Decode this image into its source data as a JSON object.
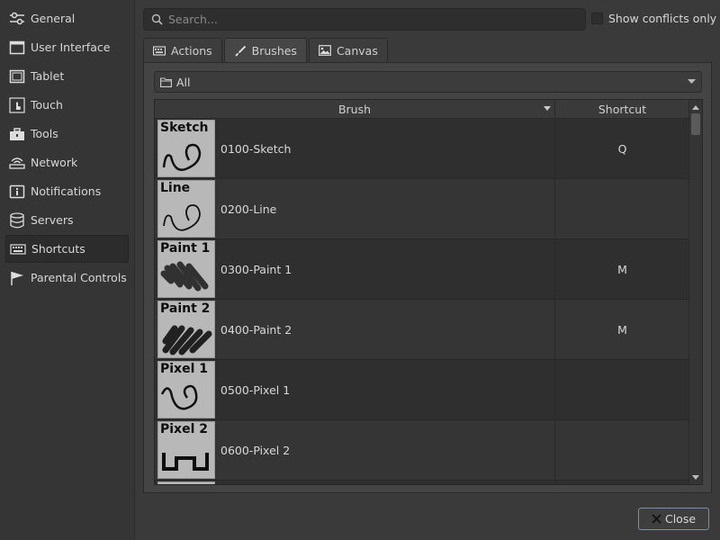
{
  "sidebar": {
    "items": [
      {
        "label": "General",
        "icon": "sliders-icon"
      },
      {
        "label": "User Interface",
        "icon": "window-icon"
      },
      {
        "label": "Tablet",
        "icon": "tablet-icon"
      },
      {
        "label": "Touch",
        "icon": "touch-icon"
      },
      {
        "label": "Tools",
        "icon": "toolbox-icon"
      },
      {
        "label": "Network",
        "icon": "router-icon"
      },
      {
        "label": "Notifications",
        "icon": "info-icon"
      },
      {
        "label": "Servers",
        "icon": "database-icon"
      },
      {
        "label": "Shortcuts",
        "icon": "keyboard-icon",
        "active": true
      },
      {
        "label": "Parental Controls",
        "icon": "flag-icon"
      }
    ]
  },
  "search": {
    "placeholder": "Search...",
    "value": ""
  },
  "conflicts": {
    "label": "Show conflicts only",
    "checked": false
  },
  "tabs": [
    {
      "label": "Actions",
      "icon": "keyboard-icon",
      "active": false
    },
    {
      "label": "Brushes",
      "icon": "brush-icon",
      "active": true
    },
    {
      "label": "Canvas",
      "icon": "image-icon",
      "active": false
    }
  ],
  "filter": {
    "value": "All",
    "icon": "folder-icon"
  },
  "table": {
    "headers": {
      "brush": "Brush",
      "shortcut": "Shortcut"
    },
    "rows": [
      {
        "thumb_title": "Sketch",
        "name": "0100-Sketch",
        "shortcut": "Q"
      },
      {
        "thumb_title": "Line",
        "name": "0200-Line",
        "shortcut": ""
      },
      {
        "thumb_title": "Paint 1",
        "name": "0300-Paint 1",
        "shortcut": "M"
      },
      {
        "thumb_title": "Paint 2",
        "name": "0400-Paint 2",
        "shortcut": "M"
      },
      {
        "thumb_title": "Pixel 1",
        "name": "0500-Pixel 1",
        "shortcut": ""
      },
      {
        "thumb_title": "Pixel 2",
        "name": "0600-Pixel 2",
        "shortcut": ""
      },
      {
        "thumb_title": "",
        "name": "",
        "shortcut": ""
      }
    ]
  },
  "footer": {
    "close_label": "Close"
  },
  "colors": {
    "background": "#3a3a3a",
    "sidebar": "#353535",
    "accent_border": "#7a8fa8"
  }
}
